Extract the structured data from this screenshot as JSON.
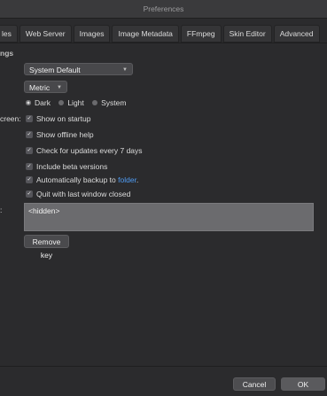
{
  "window": {
    "title": "Preferences"
  },
  "tabs": [
    {
      "label": "les"
    },
    {
      "label": "Web Server"
    },
    {
      "label": "Images"
    },
    {
      "label": "Image Metadata"
    },
    {
      "label": "FFmpeg"
    },
    {
      "label": "Skin Editor"
    },
    {
      "label": "Advanced"
    }
  ],
  "settings": {
    "section_label": "ngs",
    "language_select": {
      "value": "System Default"
    },
    "units_select": {
      "value": "Metric"
    },
    "theme": {
      "options": [
        "Dark",
        "Light",
        "System"
      ],
      "selected": "Dark"
    },
    "screen_label": "creen:",
    "checkboxes": [
      {
        "label": "Show on startup",
        "checked": true
      },
      {
        "label": "Show offline help",
        "checked": true
      },
      {
        "label": "Check for updates every 7 days",
        "checked": true
      },
      {
        "label": "Include beta versions",
        "checked": true
      },
      {
        "label": "Automatically backup to",
        "link": "folder",
        "suffix": ".",
        "checked": true
      },
      {
        "label": "Quit with last window closed",
        "checked": true
      }
    ],
    "key_label": ":",
    "key_value": "<hidden>",
    "remove_key_label": "Remove key"
  },
  "footer": {
    "cancel_label": "Cancel",
    "ok_label": "OK"
  }
}
